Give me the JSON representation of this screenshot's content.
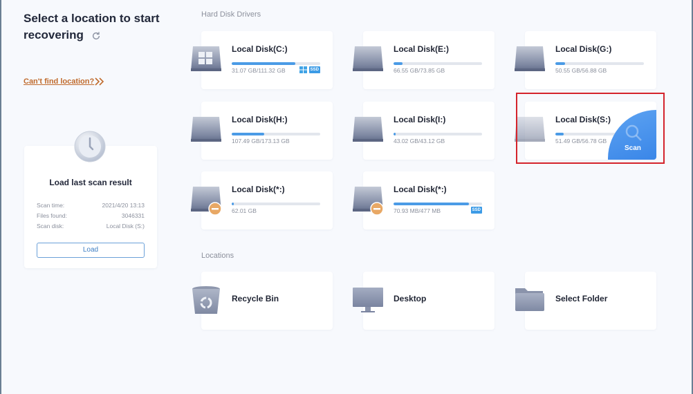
{
  "header": {
    "title": "Select a location to start recovering",
    "refresh_icon": "refresh-icon"
  },
  "help_link": {
    "label": "Can't find location?",
    "icon": "double-chevron-right-icon"
  },
  "last_scan": {
    "title": "Load last scan result",
    "rows": [
      {
        "label": "Scan time:",
        "value": "2021/4/20 13:13"
      },
      {
        "label": "Files found:",
        "value": "3046331"
      },
      {
        "label": "Scan disk:",
        "value": "Local Disk (S:)"
      }
    ],
    "load_label": "Load"
  },
  "sections": {
    "disks_label": "Hard Disk Drivers",
    "locations_label": "Locations"
  },
  "disks": [
    {
      "name": "Local Disk(C:)",
      "size": "31.07 GB/111.32 GB",
      "used_fraction": 0.72,
      "system": true,
      "ssd": true,
      "icon": "windows-drive-icon"
    },
    {
      "name": "Local Disk(E:)",
      "size": "66.55 GB/73.85 GB",
      "used_fraction": 0.1,
      "ssd": false,
      "icon": "drive-icon"
    },
    {
      "name": "Local Disk(G:)",
      "size": "50.55 GB/56.88 GB",
      "used_fraction": 0.11,
      "ssd": false,
      "icon": "drive-icon"
    },
    {
      "name": "Local Disk(H:)",
      "size": "107.49 GB/173.13 GB",
      "used_fraction": 0.37,
      "ssd": false,
      "icon": "drive-icon"
    },
    {
      "name": "Local Disk(I:)",
      "size": "43.02 GB/43.12 GB",
      "used_fraction": 0.01,
      "ssd": false,
      "icon": "drive-icon"
    },
    {
      "name": "Local Disk(S:)",
      "size": "51.49 GB/56.78 GB",
      "used_fraction": 0.09,
      "ssd": false,
      "icon": "drive-icon",
      "hovered": true,
      "scan_label": "Scan"
    },
    {
      "name": "Local Disk(*:)",
      "size": "62.01 GB",
      "used_fraction": 0.01,
      "ssd": false,
      "icon": "unmounted-drive-icon"
    },
    {
      "name": "Local Disk(*:)",
      "size": "70.93 MB/477 MB",
      "used_fraction": 0.85,
      "ssd": true,
      "icon": "unmounted-drive-icon"
    }
  ],
  "locations": [
    {
      "name": "Recycle Bin",
      "icon": "recycle-bin-icon"
    },
    {
      "name": "Desktop",
      "icon": "desktop-icon"
    },
    {
      "name": "Select Folder",
      "icon": "folder-icon"
    }
  ],
  "badges": {
    "ssd": "SSD"
  },
  "colors": {
    "accent": "#4b9be6",
    "link": "#c06a2c",
    "highlight": "#d4232b"
  }
}
